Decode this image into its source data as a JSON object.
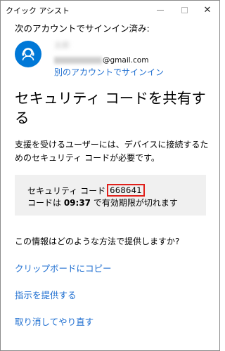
{
  "window": {
    "title": "クイック アシスト",
    "minimize_glyph": "—",
    "maximize_glyph": "☐",
    "close_glyph": "✕"
  },
  "account": {
    "signed_in_label": "次のアカウントでサインイン済み:",
    "name": "太郎",
    "email_domain": "@gmail.com",
    "switch_account_link": "別のアカウントでサインイン",
    "avatar_icon": "headset-user-icon",
    "avatar_color": "#0078d7"
  },
  "main": {
    "heading": "セキュリティ コードを共有する",
    "description": "支援を受けるユーザーには、デバイスに接続するためのセキュリティ コードが必要です。",
    "code_box": {
      "label": "セキュリティ コード",
      "code": "668641",
      "expiry_prefix": "コードは ",
      "expiry_time": "09:37",
      "expiry_suffix": " で有効期限が切れます"
    },
    "question": "この情報はどのような方法で提供しますか?",
    "actions": [
      "クリップボードにコピー",
      "指示を提供する",
      "取り消してやり直す"
    ]
  },
  "colors": {
    "link": "#1f6fd1",
    "highlight_border": "#e0201b",
    "code_box_bg": "#f0f0f0"
  }
}
